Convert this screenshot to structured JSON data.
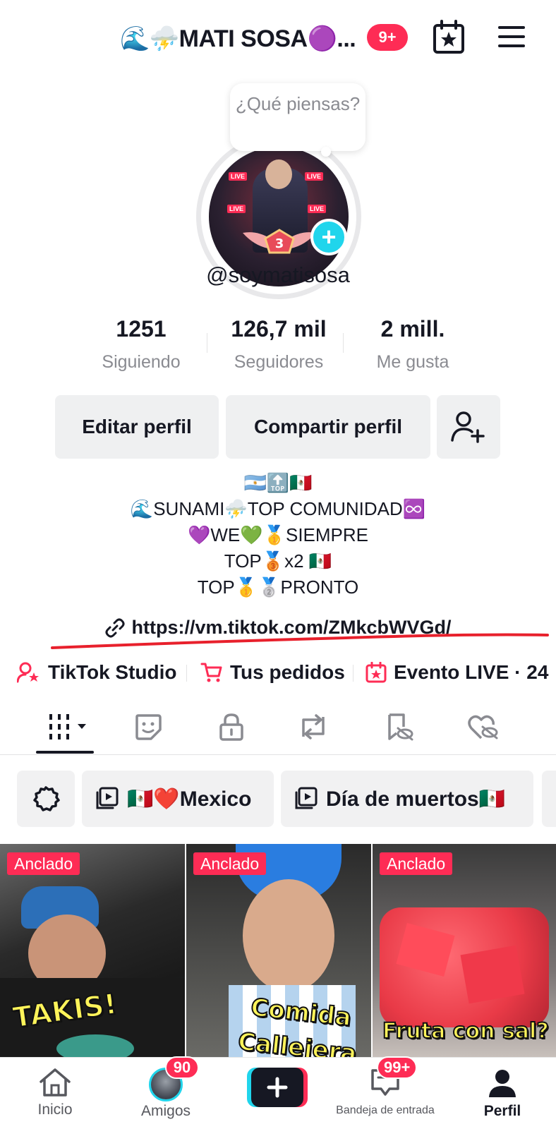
{
  "header": {
    "title": "🌊⛈️MATI SOSA🟣...",
    "notification_count": "9+"
  },
  "profile": {
    "thought_bubble": "¿Qué piensas?",
    "username": "@soymatisosa",
    "avatar_badge_level": "3",
    "stats": [
      {
        "value": "1251",
        "label": "Siguiendo"
      },
      {
        "value": "126,7 mil",
        "label": "Seguidores"
      },
      {
        "value": "2 mill.",
        "label": "Me gusta"
      }
    ],
    "edit_button": "Editar perfil",
    "share_button": "Compartir perfil",
    "bio_lines": [
      "🇦🇷🔝🇲🇽",
      "🌊SUNAMI⛈️TOP COMUNIDAD♾️",
      "💜WE💚🥇SIEMPRE",
      "TOP🥉x2 🇲🇽",
      "TOP🥇🥈PRONTO"
    ],
    "bio_link": "https://vm.tiktok.com/ZMkcbWVGd/"
  },
  "quick_links": [
    {
      "label": "TikTok Studio",
      "icon": "user-star-icon"
    },
    {
      "label": "Tus pedidos",
      "icon": "cart-icon"
    },
    {
      "label": "Evento LIVE · 24",
      "icon": "calendar-star-icon"
    }
  ],
  "tabs": [
    {
      "name": "videos",
      "icon": "grid-bars-icon"
    },
    {
      "name": "stickers",
      "icon": "sticker-icon"
    },
    {
      "name": "private",
      "icon": "lock-icon"
    },
    {
      "name": "reposts",
      "icon": "repost-icon"
    },
    {
      "name": "favorites",
      "icon": "bookmark-hidden-icon"
    },
    {
      "name": "liked",
      "icon": "heart-hidden-icon"
    }
  ],
  "playlists": [
    {
      "label": "🇲🇽❤️Mexico"
    },
    {
      "label": "Día de muertos🇲🇽"
    }
  ],
  "videos": [
    {
      "tag": "Anclado",
      "caption": "TAKIS!"
    },
    {
      "tag": "Anclado",
      "caption": "Comida Callejera"
    },
    {
      "tag": "Anclado",
      "caption": "Fruta con sal?"
    }
  ],
  "bottom_nav": {
    "home": "Inicio",
    "friends": "Amigos",
    "friends_badge": "90",
    "inbox": "Bandeja de entrada",
    "inbox_badge": "99+",
    "profile": "Perfil"
  },
  "colors": {
    "accent": "#fe2c55",
    "cyan": "#20d5ec",
    "text": "#161823",
    "muted": "#8a8b91"
  }
}
